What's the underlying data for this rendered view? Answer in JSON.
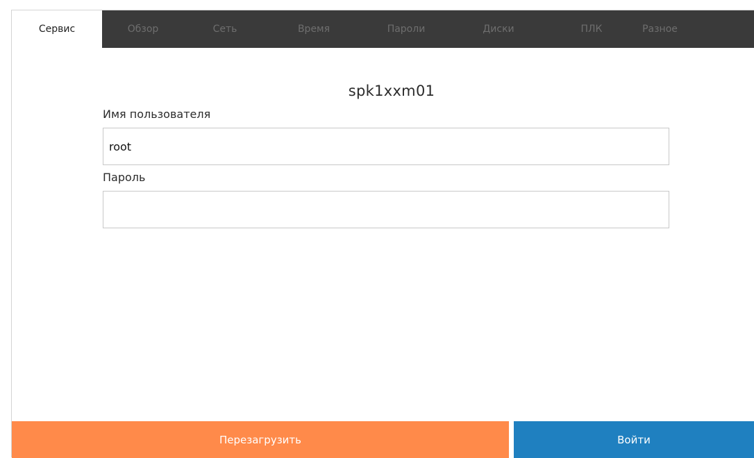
{
  "tabs": [
    {
      "label": "Сервис",
      "active": true
    },
    {
      "label": "Обзор",
      "active": false
    },
    {
      "label": "Сеть",
      "active": false
    },
    {
      "label": "Время",
      "active": false
    },
    {
      "label": "Пароли",
      "active": false
    },
    {
      "label": "Диски",
      "active": false
    },
    {
      "label": "ПЛК",
      "active": false
    },
    {
      "label": "Разное",
      "active": false
    }
  ],
  "login": {
    "hostname": "spk1xxm01",
    "username_label": "Имя пользователя",
    "username_value": "root",
    "password_label": "Пароль",
    "password_value": ""
  },
  "actions": {
    "reboot_label": "Перезагрузить",
    "login_label": "Войти"
  },
  "colors": {
    "tabbar_bg": "#3a3a3a",
    "reboot_button": "#ff8a4a",
    "login_button": "#1f80c0"
  }
}
